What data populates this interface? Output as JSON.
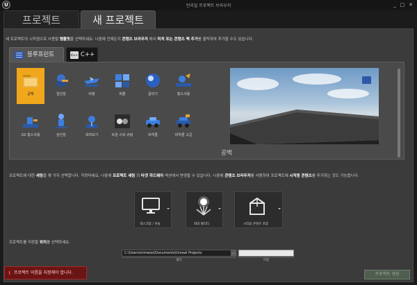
{
  "window": {
    "title": "언리얼 프로젝트 브라우저",
    "minimize": "_",
    "maximize": "□",
    "close": "✕",
    "logo": "U"
  },
  "main_tabs": [
    {
      "label": "프로젝트",
      "active": false
    },
    {
      "label": "새 프로젝트",
      "active": true
    }
  ],
  "intro": {
    "part1": "새 프로젝트의 시작점으로 사용될 ",
    "b1": "템플릿",
    "part2": "을 선택하세요. 나중에 언제든지 ",
    "b2": "콘텐츠 브라우저",
    "part3": " 에서 ",
    "b3": "피처 또는 콘텐츠 팩 추가",
    "part4": "를 클릭하여 추가할 수도 있습니다."
  },
  "sub_tabs": [
    {
      "label": "블루프린트",
      "active": true
    },
    {
      "label": "C++",
      "active": false,
      "icon_text": "C++"
    }
  ],
  "templates": [
    {
      "label": "공백",
      "selected": true,
      "icon": "folder-icon"
    },
    {
      "label": "일인칭",
      "icon": "first-person-icon"
    },
    {
      "label": "비행",
      "icon": "flying-icon"
    },
    {
      "label": "퍼즐",
      "icon": "puzzle-icon"
    },
    {
      "label": "굴리기",
      "icon": "rolling-icon"
    },
    {
      "label": "횡스크롤",
      "icon": "side-scroller-icon"
    },
    {
      "label": "2D 횡스크롤",
      "icon": "2d-side-scroller-icon"
    },
    {
      "label": "삼인칭",
      "icon": "third-person-icon"
    },
    {
      "label": "내려보기",
      "icon": "top-down-icon"
    },
    {
      "label": "트윈 스틱 슈팅",
      "icon": "twin-stick-shooter-icon"
    },
    {
      "label": "비히클",
      "icon": "vehicle-icon"
    },
    {
      "label": "비히클 고급",
      "icon": "vehicle-advanced-icon"
    }
  ],
  "preview": {
    "name": "공백"
  },
  "settings_desc": {
    "p1": "프로젝트에 대한 ",
    "b1": "세팅",
    "p2": "을 몇 가지 선택합니다. 걱정마세요, 나중에 ",
    "b2": "프로젝트 세팅",
    "p3": " 의 ",
    "b3": "타겟 하드웨어",
    "p4": " 섹션에서 변경할 수 있습니다. 나중에 ",
    "b4": "콘텐츠 브라우저",
    "p5": "를 사용하여 프로젝트에 ",
    "b5": "시작용 콘텐츠",
    "p6": "를 추가하는 것도 가능합니다."
  },
  "settings": [
    {
      "label": "데스크탑 / 콘솔",
      "icon": "monitor-icon"
    },
    {
      "label": "최대 퀄리티",
      "icon": "quality-icon"
    },
    {
      "label": "시작용 콘텐츠 포함",
      "icon": "starter-content-icon"
    }
  ],
  "location": {
    "p1": "프로젝트를 저장할 ",
    "b1": "위치",
    "p2": "를 선택하세요.",
    "folder_value": "C:\\Users\\minwoo\\Documents\\Unreal Projects",
    "folder_browse": "...",
    "folder_caption": "폴더",
    "name_value": "",
    "name_caption": "이름"
  },
  "error": {
    "icon": "!",
    "message": "프로젝트 이름을 지정해야 합니다."
  },
  "create_button": "프로젝트 생성",
  "colors": {
    "selected_template": "#f0a71b",
    "error_bg": "#6b1414",
    "create_button_bg": "#4f5e4f"
  }
}
